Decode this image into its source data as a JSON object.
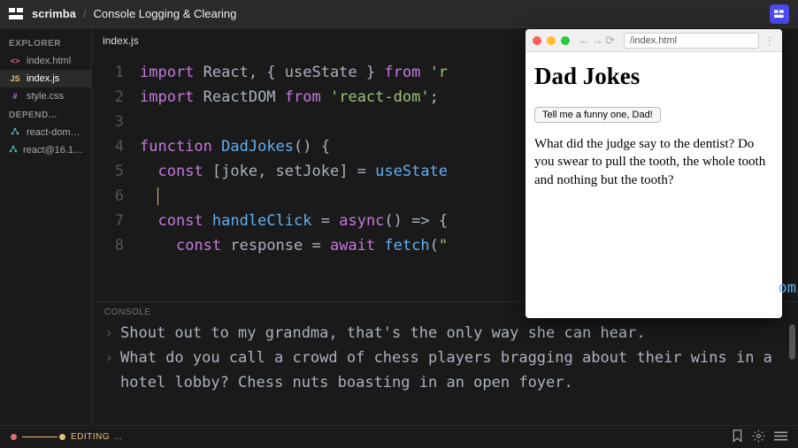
{
  "header": {
    "brand": "scrimba",
    "title": "Console Logging & Clearing"
  },
  "sidebar": {
    "explorer_label": "EXPLORER",
    "files": [
      {
        "icon": "<>",
        "icon_class": "fi-html",
        "name": "index.html",
        "active": false
      },
      {
        "icon": "JS",
        "icon_class": "fi-js",
        "name": "index.js",
        "active": true
      },
      {
        "icon": "#",
        "icon_class": "fi-css",
        "name": "style.css",
        "active": false
      }
    ],
    "depend_label": "DEPEND…",
    "deps": [
      {
        "name": "react-dom…"
      },
      {
        "name": "react@16.1…"
      }
    ]
  },
  "tab": {
    "name": "index.js"
  },
  "code_lines": [
    [
      {
        "c": "tok-kw",
        "t": "import"
      },
      {
        "c": "tok-pl",
        "t": " React, { useState } "
      },
      {
        "c": "tok-kw",
        "t": "from"
      },
      {
        "c": "tok-pl",
        "t": " "
      },
      {
        "c": "tok-str",
        "t": "'r"
      }
    ],
    [
      {
        "c": "tok-kw",
        "t": "import"
      },
      {
        "c": "tok-pl",
        "t": " ReactDOM "
      },
      {
        "c": "tok-kw",
        "t": "from"
      },
      {
        "c": "tok-pl",
        "t": " "
      },
      {
        "c": "tok-str",
        "t": "'react-dom'"
      },
      {
        "c": "tok-punc",
        "t": ";"
      }
    ],
    [],
    [
      {
        "c": "tok-kw",
        "t": "function"
      },
      {
        "c": "tok-pl",
        "t": " "
      },
      {
        "c": "tok-fn",
        "t": "DadJokes"
      },
      {
        "c": "tok-punc",
        "t": "() {"
      }
    ],
    [
      {
        "c": "tok-pl",
        "t": "  "
      },
      {
        "c": "tok-kw",
        "t": "const"
      },
      {
        "c": "tok-pl",
        "t": " [joke, setJoke] = "
      },
      {
        "c": "tok-fn",
        "t": "useState"
      }
    ],
    [
      {
        "c": "tok-pl",
        "t": "  "
      },
      {
        "cursor": true
      }
    ],
    [
      {
        "c": "tok-pl",
        "t": "  "
      },
      {
        "c": "tok-kw",
        "t": "const"
      },
      {
        "c": "tok-pl",
        "t": " "
      },
      {
        "c": "tok-fn",
        "t": "handleClick"
      },
      {
        "c": "tok-pl",
        "t": " = "
      },
      {
        "c": "tok-kw",
        "t": "async"
      },
      {
        "c": "tok-punc",
        "t": "() => {"
      }
    ],
    [
      {
        "c": "tok-pl",
        "t": "    "
      },
      {
        "c": "tok-kw",
        "t": "const"
      },
      {
        "c": "tok-pl",
        "t": " response = "
      },
      {
        "c": "tok-kw",
        "t": "await"
      },
      {
        "c": "tok-pl",
        "t": " "
      },
      {
        "c": "tok-fn",
        "t": "fetch"
      },
      {
        "c": "tok-punc",
        "t": "("
      },
      {
        "c": "tok-str",
        "t": "\""
      }
    ]
  ],
  "console": {
    "label": "CONSOLE",
    "lines": [
      "Shout out to my grandma, that's the only way she can hear.",
      "What do you call a crowd of chess players bragging about their wins in a hotel lobby? Chess nuts boasting in an open foyer."
    ]
  },
  "status": {
    "text": "EDITING",
    "dots": "…"
  },
  "preview": {
    "url": "/index.html",
    "heading": "Dad Jokes",
    "button": "Tell me a funny one, Dad!",
    "joke": "What did the judge say to the dentist? Do you swear to pull the tooth, the whole tooth and nothing but the tooth?"
  },
  "cutoff": "om"
}
